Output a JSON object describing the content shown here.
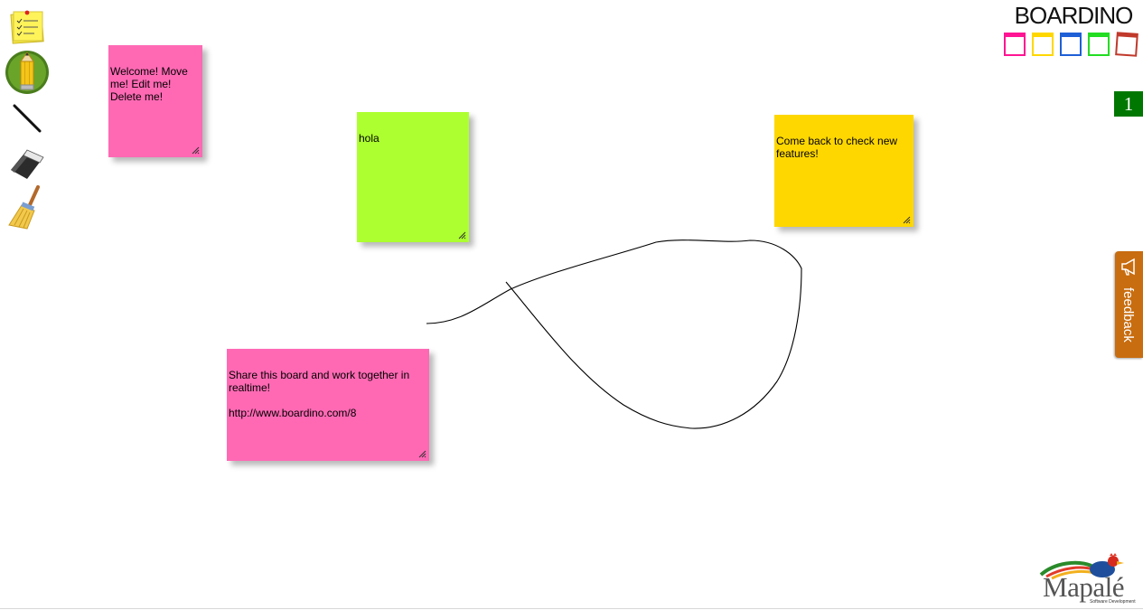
{
  "toolbar": {
    "tools": [
      {
        "name": "new-note",
        "icon": "sticky-notes-icon"
      },
      {
        "name": "pencil",
        "icon": "pencil-icon"
      },
      {
        "name": "line",
        "icon": "line-icon"
      },
      {
        "name": "eraser",
        "icon": "eraser-icon"
      },
      {
        "name": "broom",
        "icon": "broom-icon"
      }
    ]
  },
  "notes": [
    {
      "text": "Welcome! Move me! Edit me! Delete me!",
      "color": "#ff69b4"
    },
    {
      "text": "hola",
      "color": "#adff2f"
    },
    {
      "text": "Come back to check new features!",
      "color": "#ffd700"
    },
    {
      "text": "Share this board and work together in realtime!\n\nhttp://www.boardino.com/8",
      "color": "#ff69b4"
    }
  ],
  "logo": {
    "text": "BOARDINO",
    "square_colors": [
      "#ff1493",
      "#ffd700",
      "#1e5fd6",
      "#22dd22",
      "#c0392b"
    ]
  },
  "counter": {
    "value": "1",
    "color": "#007700"
  },
  "feedback": {
    "label": "feedback",
    "color": "#c86d10"
  },
  "footer_logo": {
    "text": "Mapalé",
    "subtitle": "Software Development"
  }
}
